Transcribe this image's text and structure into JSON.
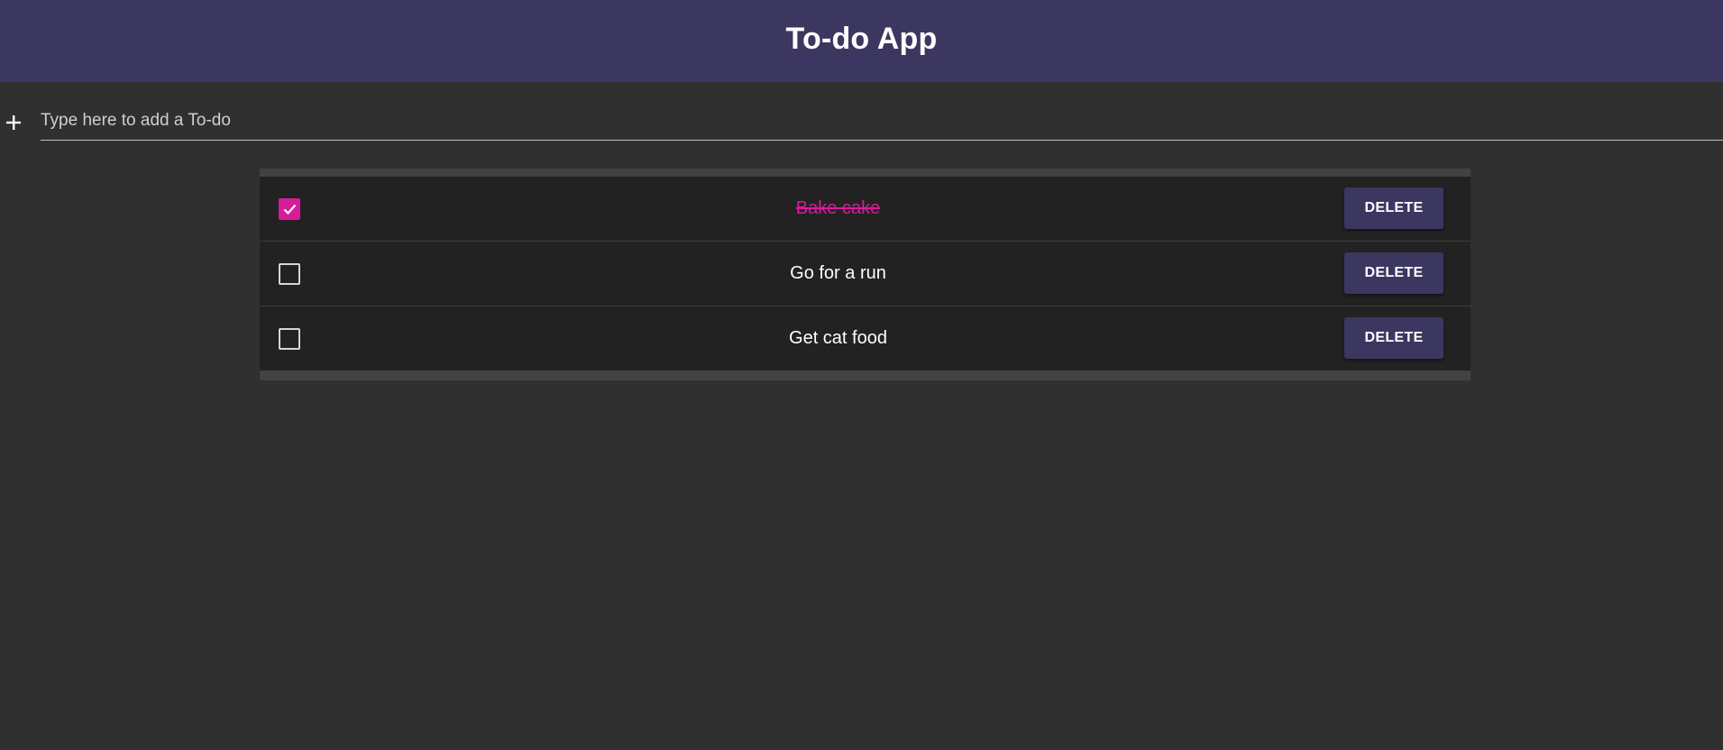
{
  "header": {
    "title": "To-do App"
  },
  "add_todo": {
    "icon": "plus-icon",
    "placeholder": "Type here to add a To-do",
    "value": ""
  },
  "todos": [
    {
      "text": "Bake cake",
      "completed": true,
      "delete_label": "DELETE"
    },
    {
      "text": "Go for a run",
      "completed": false,
      "delete_label": "DELETE"
    },
    {
      "text": "Get cat food",
      "completed": false,
      "delete_label": "DELETE"
    }
  ],
  "colors": {
    "header_bg": "#3b3760",
    "page_bg": "#303030",
    "accent": "#d81b9a",
    "button_bg": "#3b3760"
  }
}
